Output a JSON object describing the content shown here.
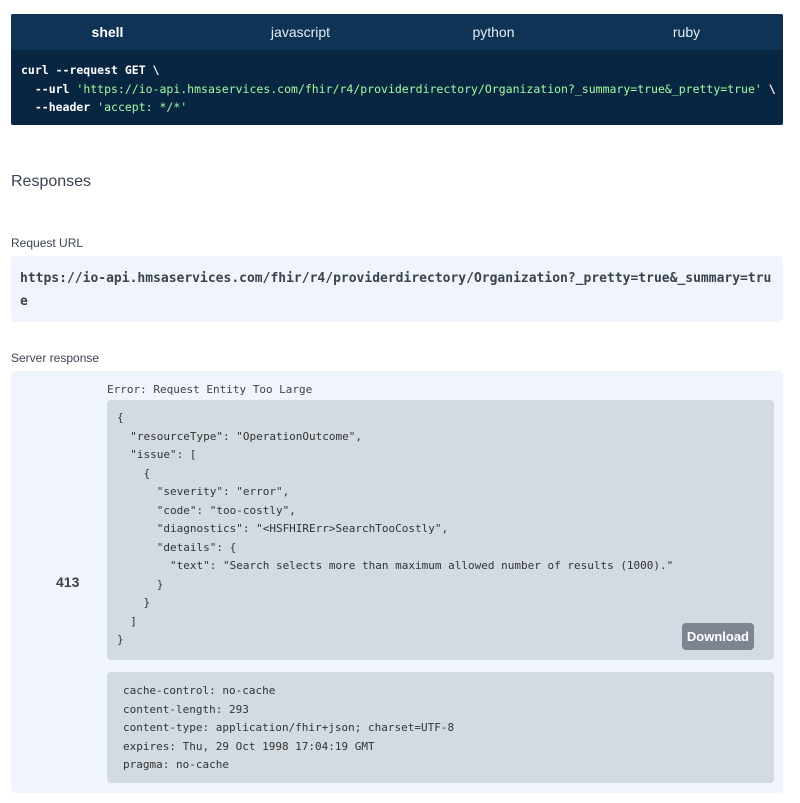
{
  "code_tabs": {
    "tabs": [
      "shell",
      "javascript",
      "python",
      "ruby"
    ],
    "active": "shell"
  },
  "code_sample": {
    "line1": "curl --request GET \\",
    "line2_flag": "  --url ",
    "line2_url": "'https://io-api.hmsaservices.com/fhir/r4/providerdirectory/Organization?_summary=true&_pretty=true'",
    "line2_tail": " \\",
    "line3_flag": "  --header ",
    "line3_val": "'accept: */*'"
  },
  "responses": {
    "title": "Responses",
    "request_url_label": "Request URL",
    "request_url": "https://io-api.hmsaservices.com/fhir/r4/providerdirectory/Organization?_pretty=true&_summary=true",
    "server_response_label": "Server response",
    "status_code": "413",
    "error_title": "Error: Request Entity Too Large",
    "body_lines": [
      "{",
      "  \"resourceType\": \"OperationOutcome\",",
      "  \"issue\": [",
      "    {",
      "      \"severity\": \"error\",",
      "      \"code\": \"too-costly\",",
      "      \"diagnostics\": \"<HSFHIRErr>SearchTooCostly\",",
      "      \"details\": {",
      "        \"text\": \"Search selects more than maximum allowed number of results (1000).\"",
      "      }",
      "    }",
      "  ]",
      "}"
    ],
    "download_label": "Download",
    "headers": [
      "cache-control: no-cache",
      "content-length: 293",
      "content-type: application/fhir+json; charset=UTF-8",
      "expires: Thu, 29 Oct 1998 17:04:19 GMT",
      "pragma: no-cache"
    ]
  }
}
